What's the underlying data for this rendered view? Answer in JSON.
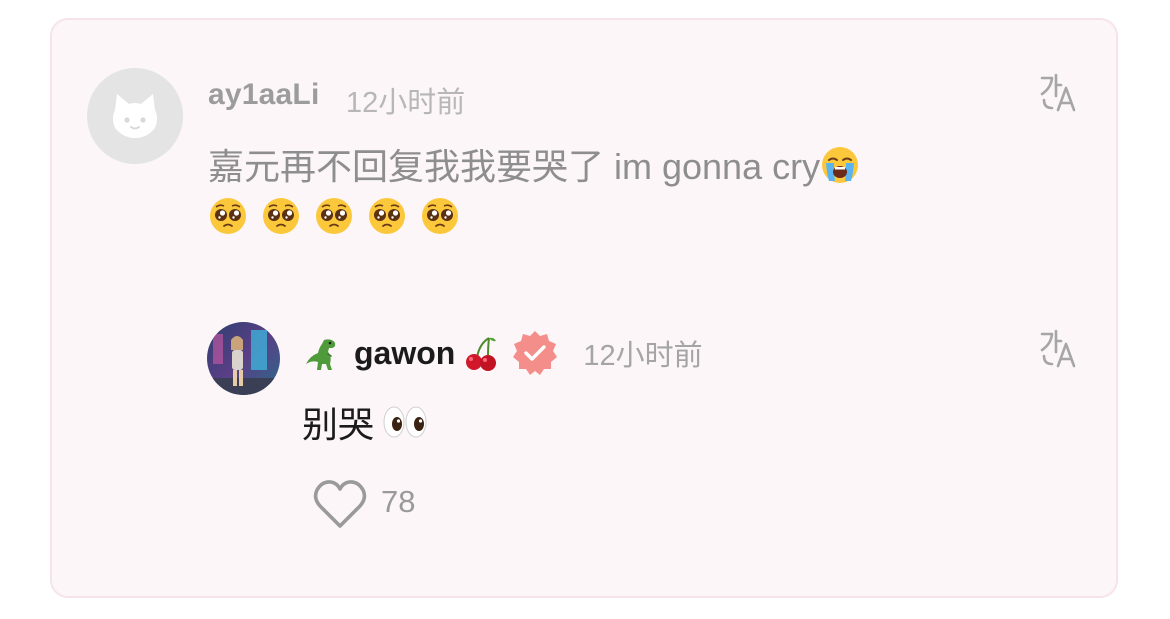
{
  "comment": {
    "username": "ay1aaLi",
    "time": "12小时前",
    "text": "嘉元再不回复我我要哭了 im gonna cry",
    "trailing_emoji": "loudly-crying-face",
    "emoji_row": [
      "pleading-face",
      "pleading-face",
      "pleading-face",
      "pleading-face",
      "pleading-face"
    ],
    "avatar": "cat-placeholder-icon"
  },
  "reply": {
    "prefix_emoji": "t-rex",
    "username": "gawon",
    "suffix_emoji": "cherries",
    "verified": true,
    "time": "12小时前",
    "text": "别哭",
    "text_emoji": "eyes",
    "like_count": "78"
  },
  "colors": {
    "card_background": "#fcf6f8",
    "card_border": "#f7e3ea",
    "verified_badge": "#f48e8b"
  },
  "icons": {
    "translate": "translate-icon",
    "like": "heart-outline-icon"
  }
}
